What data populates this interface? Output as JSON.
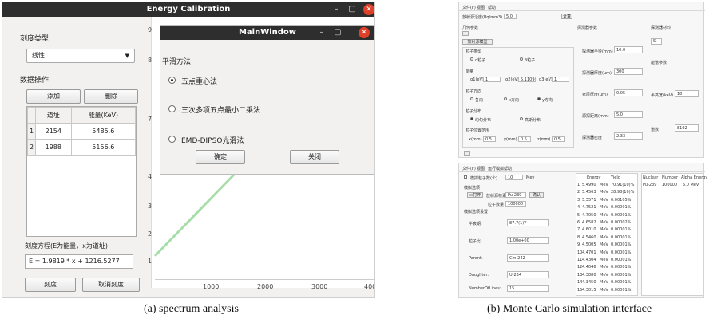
{
  "left": {
    "title": "Energy Calibration",
    "title_controls": [
      "–",
      "▢"
    ],
    "close": "✕",
    "scale_type_label": "刻度类型",
    "scale_type_value": "线性",
    "data_ops_label": "数据操作",
    "add_button": "添加",
    "delete_button": "删除",
    "table_headers": [
      "道址",
      "能量(KeV)"
    ],
    "table_rows": [
      {
        "index": "1",
        "channel": "2154",
        "energy": "5485.6"
      },
      {
        "index": "2",
        "channel": "1988",
        "energy": "5156.6"
      }
    ],
    "equation_label": "刻度方程(E为能量，x为道址)",
    "equation_value": "E = 1.9819 * x + 1216.5277",
    "calibrate_button": "刻度",
    "cancel_button": "取消刻度",
    "plot": {
      "y_ticks": [
        "9",
        "8",
        "7",
        "4",
        "3",
        "2",
        "1"
      ],
      "x_ticks": [
        "1000",
        "2000",
        "3000",
        "4000"
      ]
    },
    "dialog": {
      "title": "MainWindow",
      "section_label": "平滑方法",
      "options": [
        {
          "label": "五点重心法",
          "selected": true
        },
        {
          "label": "三次多项五点最小二乘法",
          "selected": false
        },
        {
          "label": "EMD-DIPSO光滑法",
          "selected": false
        }
      ],
      "ok_button": "确定",
      "close_button": "关闭"
    }
  },
  "right": {
    "top_menu": [
      "文件(F)",
      "视图",
      "帮助"
    ],
    "source_label": "放射源活度(Bq/mm3)",
    "source_value": "5.0",
    "calc_button": "计算",
    "geometry_header": "几何参数",
    "geometry_button": "放射源模型",
    "particle_label": "粒子类型",
    "particle_opts": [
      "α粒子",
      "β粒子"
    ],
    "energy_label": "能量",
    "energy_fields": [
      {
        "label": "α1(eV)",
        "value": "1"
      },
      {
        "label": "α2(eV)",
        "value": "5.11098"
      },
      {
        "label": "α3(eV)",
        "value": "1"
      }
    ],
    "direction_label": "粒子方向",
    "direction_opts": [
      "各向",
      "x方向",
      "y方向"
    ],
    "dist_label": "粒子分布",
    "dist_opts": [
      "均匀分布",
      "高斯分布"
    ],
    "pos_label": "粒子位置范围",
    "pos_fields": [
      {
        "label": "x(mm)",
        "value": "0.5"
      },
      {
        "label": "y(mm)",
        "value": "0.5"
      },
      {
        "label": "z(mm)",
        "value": "0.5"
      }
    ],
    "detector_header": "探测器参数",
    "detector_fields": [
      {
        "label": "探测器半径(mm)",
        "value": "10.0"
      },
      {
        "label": "探测器厚度(um)",
        "value": "300"
      },
      {
        "label": "死层厚度(um)",
        "value": "0.05"
      },
      {
        "label": "源探距离(mm)",
        "value": "5.0"
      },
      {
        "label": "探测器密度",
        "value": "2.33"
      }
    ],
    "material_header": "探测器材料",
    "material_value": "Si",
    "spectrum_header": "能谱参数",
    "fwhm_label": "半高宽(keV)",
    "fwhm_value": "18",
    "channels_label": "道数",
    "channels_value": "8192",
    "bottom_menu": [
      "文件(F)",
      "视图",
      "运行模拟",
      "帮助"
    ],
    "events_label": "模拟粒子数(个)",
    "events_value": "10",
    "events_unit": "Mev",
    "options_label": "模拟选项",
    "open_button": "打开",
    "source_nuclide_label": "放射源核素",
    "source_nuclide_value": "Pu-239",
    "confirm_button": "确认",
    "particle_count_label": "粒子数量",
    "particle_count_value": "100000",
    "options2_label": "模拟选项设置",
    "param_fields": [
      {
        "label": "半衰期:",
        "value": "87.7(1)Y"
      },
      {
        "label": "粒子比:",
        "value": "1.00e+00"
      },
      {
        "label": "Parent:",
        "value": "Cm-242"
      },
      {
        "label": "Daughter:",
        "value": "U-234"
      },
      {
        "label": "NumberOfLines:",
        "value": "15"
      }
    ],
    "energy_table_headers": [
      "Energy",
      "Yield"
    ],
    "energy_rows": [
      {
        "idx": "1",
        "energy": "5.4990",
        "unit": "MeV",
        "yield": "70.91(10)%"
      },
      {
        "idx": "2",
        "energy": "5.4563",
        "unit": "MeV",
        "yield": "28.98(10)%"
      },
      {
        "idx": "3",
        "energy": "5.3571",
        "unit": "MeV",
        "yield": "0.00105%"
      },
      {
        "idx": "4",
        "energy": "4.7521",
        "unit": "MeV",
        "yield": "0.00001%"
      },
      {
        "idx": "5",
        "energy": "4.7050",
        "unit": "MeV",
        "yield": "0.00001%"
      },
      {
        "idx": "6",
        "energy": "4.6582",
        "unit": "MeV",
        "yield": "0.00002%"
      },
      {
        "idx": "7",
        "energy": "4.6010",
        "unit": "MeV",
        "yield": "0.00001%"
      },
      {
        "idx": "8",
        "energy": "4.5460",
        "unit": "MeV",
        "yield": "0.00001%"
      },
      {
        "idx": "9",
        "energy": "4.5005",
        "unit": "MeV",
        "yield": "0.00001%"
      },
      {
        "idx": "10",
        "energy": "4.4701",
        "unit": "MeV",
        "yield": "0.00001%"
      },
      {
        "idx": "11",
        "energy": "4.4304",
        "unit": "MeV",
        "yield": "0.00001%"
      },
      {
        "idx": "12",
        "energy": "4.4046",
        "unit": "MeV",
        "yield": "0.00001%"
      },
      {
        "idx": "13",
        "energy": "4.3880",
        "unit": "MeV",
        "yield": "0.00001%"
      },
      {
        "idx": "14",
        "energy": "4.3450",
        "unit": "MeV",
        "yield": "0.00001%"
      },
      {
        "idx": "15",
        "energy": "4.3015",
        "unit": "MeV",
        "yield": "0.00001%"
      }
    ],
    "result_headers": [
      "Nuclear",
      "Number",
      "Alpha Energy"
    ],
    "result_row": {
      "nuclear": "Pu-239",
      "number": "100000",
      "alpha": "5.0 MeV"
    }
  },
  "captions": {
    "left": "(a) spectrum analysis",
    "right": "(b) Monte Carlo simulation interface"
  }
}
